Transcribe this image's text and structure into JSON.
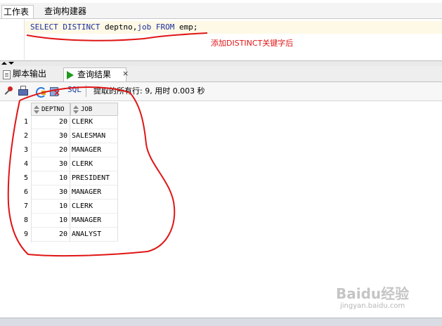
{
  "top_tabs": {
    "worksheet": "工作表",
    "query_builder": "查询构建器"
  },
  "editor": {
    "sql_keyword_select": "SELECT",
    "sql_keyword_distinct": "DISTINCT",
    "sql_columns": "deptno,",
    "sql_keyword_job": "job",
    "sql_keyword_from": "FROM",
    "sql_table": "emp;"
  },
  "annotation": {
    "text": "添加DISTINCT关键字后",
    "color": "#e01515"
  },
  "lower_tabs": {
    "script_output": "脚本输出",
    "query_result": "查询结果",
    "close": "×"
  },
  "toolbar": {
    "sql_label": "SQL",
    "status": "提取的所有行: 9, 用时 0.003 秒",
    "icons": [
      "pin-icon",
      "print-icon",
      "sql-refresh-icon",
      "delete-icon"
    ]
  },
  "grid": {
    "columns": [
      "DEPTNO",
      "JOB"
    ],
    "rows": [
      {
        "num": "1",
        "deptno": "20",
        "job": "CLERK"
      },
      {
        "num": "2",
        "deptno": "30",
        "job": "SALESMAN"
      },
      {
        "num": "3",
        "deptno": "20",
        "job": "MANAGER"
      },
      {
        "num": "4",
        "deptno": "30",
        "job": "CLERK"
      },
      {
        "num": "5",
        "deptno": "10",
        "job": "PRESIDENT"
      },
      {
        "num": "6",
        "deptno": "30",
        "job": "MANAGER"
      },
      {
        "num": "7",
        "deptno": "10",
        "job": "CLERK"
      },
      {
        "num": "8",
        "deptno": "10",
        "job": "MANAGER"
      },
      {
        "num": "9",
        "deptno": "20",
        "job": "ANALYST"
      }
    ]
  },
  "watermark": {
    "logo": "Baidu经验",
    "url": "jingyan.baidu.com"
  }
}
